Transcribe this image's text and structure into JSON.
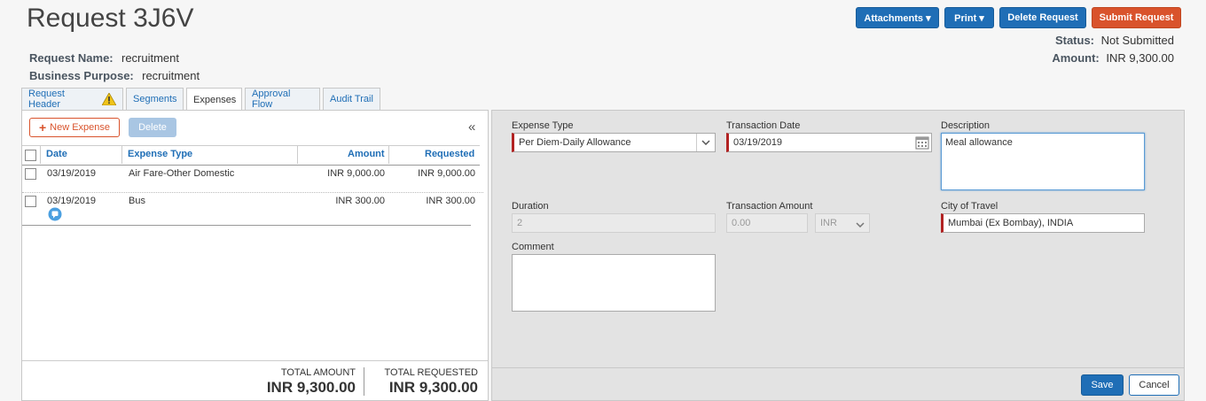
{
  "header": {
    "title": "Request 3J6V",
    "request_name_label": "Request Name:",
    "request_name_value": "recruitment",
    "business_purpose_label": "Business Purpose:",
    "business_purpose_value": "recruitment",
    "status_label": "Status:",
    "status_value": "Not Submitted",
    "amount_label": "Amount:",
    "amount_value": "INR 9,300.00"
  },
  "toolbar": {
    "attachments": "Attachments ▾",
    "print": "Print ▾",
    "delete_request": "Delete Request",
    "submit_request": "Submit Request"
  },
  "tabs": [
    "Request Header",
    "Segments",
    "Expenses",
    "Approval Flow",
    "Audit Trail"
  ],
  "left": {
    "new_expense": "New Expense",
    "delete": "Delete",
    "collapse": "«",
    "columns": [
      "Date",
      "Expense Type",
      "Amount",
      "Requested"
    ],
    "rows": [
      {
        "date": "03/19/2019",
        "type": "Air Fare-Other Domestic",
        "amount": "INR 9,000.00",
        "requested": "INR 9,000.00"
      },
      {
        "date": "03/19/2019",
        "type": "Bus",
        "amount": "INR 300.00",
        "requested": "INR 300.00"
      }
    ],
    "total_amount_label": "TOTAL AMOUNT",
    "total_amount_value": "INR 9,300.00",
    "total_requested_label": "TOTAL REQUESTED",
    "total_requested_value": "INR 9,300.00"
  },
  "form": {
    "expense_type_label": "Expense Type",
    "expense_type_value": "Per Diem-Daily Allowance",
    "transaction_date_label": "Transaction Date",
    "transaction_date_value": "03/19/2019",
    "description_label": "Description",
    "description_value": "Meal allowance",
    "duration_label": "Duration",
    "duration_value": "2",
    "transaction_amount_label": "Transaction Amount",
    "transaction_amount_value": "0.00",
    "currency_value": "INR",
    "city_label": "City of Travel",
    "city_value": "Mumbai (Ex Bombay), INDIA",
    "comment_label": "Comment",
    "comment_value": "",
    "save": "Save",
    "cancel": "Cancel"
  },
  "colors": {
    "primary": "#1f6eb6",
    "danger": "#d9532c",
    "required": "#b22222"
  },
  "icons": [
    "warning-icon",
    "plus-icon",
    "chevron-down-icon",
    "calendar-icon",
    "comment-icon",
    "collapse-icon"
  ]
}
